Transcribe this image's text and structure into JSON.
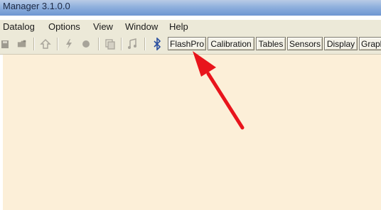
{
  "window": {
    "title": "Manager 3.1.0.0"
  },
  "menu": {
    "items": [
      "Datalog",
      "Options",
      "View",
      "Window",
      "Help"
    ]
  },
  "toolbar": {
    "icons": [
      "save-icon",
      "open-folder-icon",
      "upload-icon",
      "flash-icon",
      "record-dot-icon",
      "copy-icon",
      "music-note-icon",
      "bluetooth-icon"
    ],
    "buttons": [
      "FlashPro",
      "Calibration",
      "Tables",
      "Sensors",
      "Display",
      "Graph"
    ]
  },
  "annotation": {
    "arrow_color": "#e8141c",
    "points_to": "FlashPro"
  },
  "colors": {
    "workspace_bg": "#fcefd8",
    "toolbar_bg": "#ece9d8",
    "titlebar": "#8fb0dd"
  }
}
